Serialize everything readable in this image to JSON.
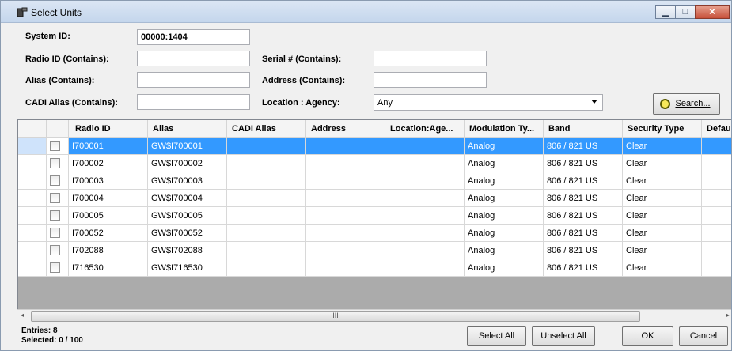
{
  "window": {
    "title": "Select Units",
    "minimize_glyph": "▁",
    "maximize_glyph": "□",
    "close_glyph": "✕"
  },
  "filters": {
    "system_id_label": "System ID:",
    "system_id_value": "00000:1404",
    "radio_id_label": "Radio ID (Contains):",
    "radio_id_value": "",
    "serial_label": "Serial # (Contains):",
    "serial_value": "",
    "alias_label": "Alias (Contains):",
    "alias_value": "",
    "address_label": "Address (Contains):",
    "address_value": "",
    "cadi_alias_label": "CADI Alias (Contains):",
    "cadi_alias_value": "",
    "location_label": "Location : Agency:",
    "location_value": "Any",
    "search_label": "Search..."
  },
  "grid": {
    "columns": [
      "Radio ID",
      "Alias",
      "CADI Alias",
      "Address",
      "Location:Age...",
      "Modulation Ty...",
      "Band",
      "Security Type",
      "Defaul"
    ],
    "rows": [
      {
        "radio_id": "I700001",
        "alias": "GW$I700001",
        "cadi_alias": "",
        "address": "",
        "location": "",
        "modulation": "Analog",
        "band": "806 / 821 US",
        "security": "Clear",
        "selected": true
      },
      {
        "radio_id": "I700002",
        "alias": "GW$I700002",
        "cadi_alias": "",
        "address": "",
        "location": "",
        "modulation": "Analog",
        "band": "806 / 821 US",
        "security": "Clear",
        "selected": false
      },
      {
        "radio_id": "I700003",
        "alias": "GW$I700003",
        "cadi_alias": "",
        "address": "",
        "location": "",
        "modulation": "Analog",
        "band": "806 / 821 US",
        "security": "Clear",
        "selected": false
      },
      {
        "radio_id": "I700004",
        "alias": "GW$I700004",
        "cadi_alias": "",
        "address": "",
        "location": "",
        "modulation": "Analog",
        "band": "806 / 821 US",
        "security": "Clear",
        "selected": false
      },
      {
        "radio_id": "I700005",
        "alias": "GW$I700005",
        "cadi_alias": "",
        "address": "",
        "location": "",
        "modulation": "Analog",
        "band": "806 / 821 US",
        "security": "Clear",
        "selected": false
      },
      {
        "radio_id": "I700052",
        "alias": "GW$I700052",
        "cadi_alias": "",
        "address": "",
        "location": "",
        "modulation": "Analog",
        "band": "806 / 821 US",
        "security": "Clear",
        "selected": false
      },
      {
        "radio_id": "I702088",
        "alias": "GW$I702088",
        "cadi_alias": "",
        "address": "",
        "location": "",
        "modulation": "Analog",
        "band": "806 / 821 US",
        "security": "Clear",
        "selected": false
      },
      {
        "radio_id": "I716530",
        "alias": "GW$I716530",
        "cadi_alias": "",
        "address": "",
        "location": "",
        "modulation": "Analog",
        "band": "806 / 821 US",
        "security": "Clear",
        "selected": false
      }
    ]
  },
  "scrollbar": {
    "left_arrow": "◂",
    "right_arrow": "▸",
    "grip": "III"
  },
  "footer": {
    "entries": "Entries: 8",
    "selected": "Selected: 0 / 100",
    "select_all": "Select All",
    "unselect_all": "Unselect All",
    "ok": "OK",
    "cancel": "Cancel"
  }
}
